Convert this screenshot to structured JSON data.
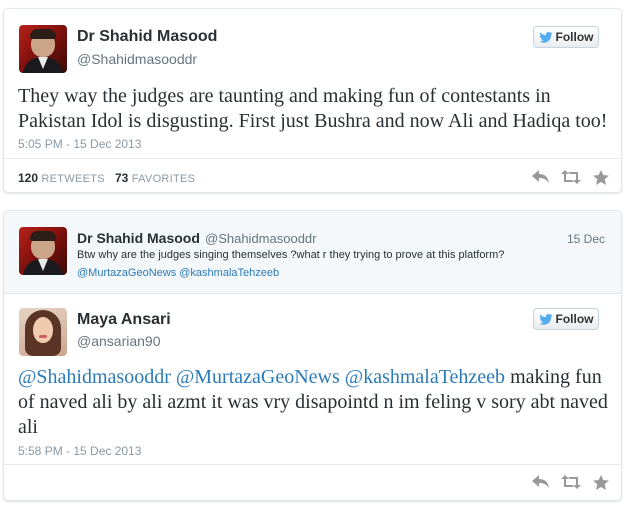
{
  "tweet1": {
    "name": "Dr Shahid Masood",
    "handle": "@Shahidmasooddr",
    "follow_label": "Follow",
    "text_line1": "They way the judges are taunting and making fun of contestants in",
    "text_line2": "Pakistan Idol is disgusting. First just Bushra and now Ali and Hadiqa too!",
    "timestamp": "5:05 PM - 15 Dec 2013",
    "retweets_count": "120",
    "retweets_label": "RETWEETS",
    "favorites_count": "73",
    "favorites_label": "FAVORITES",
    "icons": [
      "reply-icon",
      "retweet-icon",
      "favorite-icon"
    ]
  },
  "in_reply_to": {
    "name": "Dr Shahid Masood",
    "handle": "@Shahidmasooddr",
    "date": "15 Dec",
    "text": "Btw why are the judges singing themselves ?what r they trying to prove at  this platform?",
    "mention1": "@MurtazaGeoNews",
    "mention2": "@kashmalaTehzeeb"
  },
  "tweet2": {
    "name": "Maya Ansari",
    "handle": "@ansarian90",
    "follow_label": "Follow",
    "mention1": "@Shahidmasooddr",
    "mention2": "@MurtazaGeoNews",
    "mention3": "@kashmalaTehzeeb",
    "text_line1_rest": " making fun",
    "text_line2": "of naved ali by ali azmt it was vry disapointd n im feling v sory abt naved",
    "text_line3": "ali",
    "timestamp": "5:58 PM - 15 Dec 2013",
    "icons": [
      "reply-icon",
      "retweet-icon",
      "favorite-icon"
    ]
  },
  "colors": {
    "link": "#2b7bb9",
    "twitter_bird": "#55acee",
    "muted": "#8899a6"
  }
}
